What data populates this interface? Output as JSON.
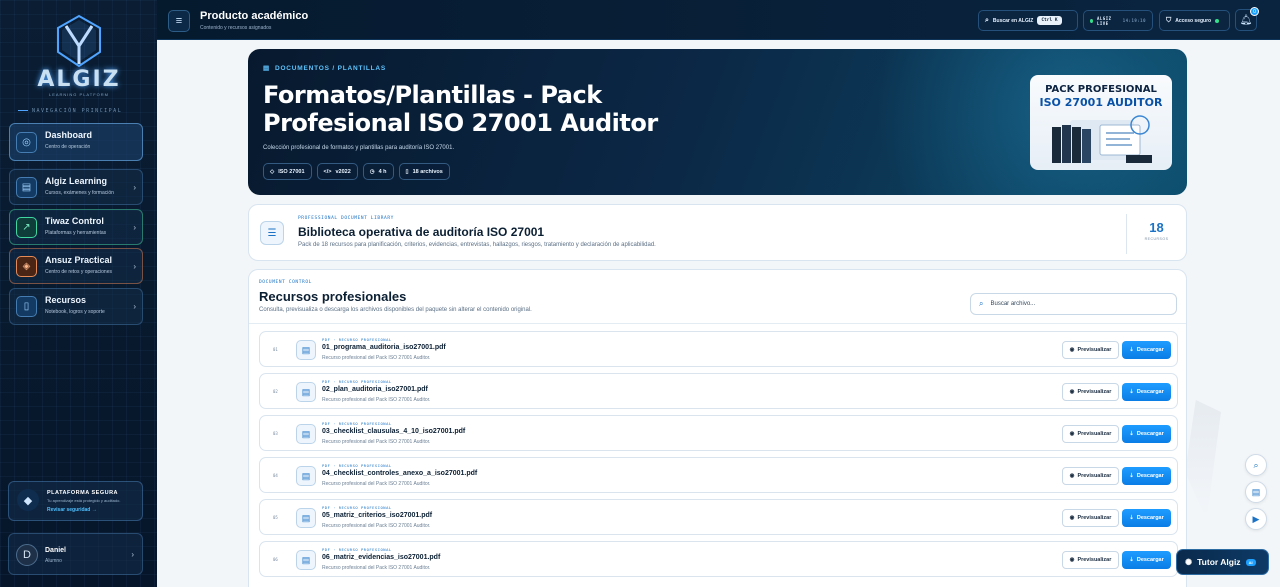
{
  "sidebar": {
    "logo_text": "ALGIZ",
    "logo_sub": "LEARNING PLATFORM",
    "nav_title": "NAVEGACIÓN PRINCIPAL",
    "items": [
      {
        "label": "Dashboard",
        "sub": "Centro de operación",
        "icon": "target-icon"
      },
      {
        "label": "Algiz Learning",
        "sub": "Cursos, exámenes y formación",
        "icon": "book-icon"
      },
      {
        "label": "Tiwaz Control",
        "sub": "Plataformas y herramientas",
        "icon": "arrow-icon"
      },
      {
        "label": "Ansuz Practical",
        "sub": "Centro de retos y operaciones",
        "icon": "shield-icon"
      },
      {
        "label": "Recursos",
        "sub": "Notebook, logros y soporte",
        "icon": "doc-icon"
      }
    ],
    "secure": {
      "title": "PLATAFORMA SEGURA",
      "sub": "Tu aprendizaje está protegido y auditado.",
      "link": "Revisar seguridad →"
    },
    "user": {
      "name": "Daniel",
      "role": "Alumno",
      "initial": "D"
    }
  },
  "header": {
    "title": "Producto académico",
    "subtitle": "Contenido y recursos asignados",
    "search_label": "Buscar en ALGIZ",
    "search_kbd": "Ctrl K",
    "live_label": "ALGIZ LIVE",
    "live_time": "14:19:10",
    "secure_label": "Acceso seguro",
    "notif_count": "0"
  },
  "hero": {
    "breadcrumb": "DOCUMENTOS / PLANTILLAS",
    "title": "Formatos/Plantillas - Pack Profesional ISO 27001 Auditor",
    "description": "Colección profesional de formatos y plantillas para auditoría ISO 27001.",
    "chips": [
      "ISO 27001",
      "v2022",
      "4 h",
      "18 archivos"
    ],
    "cover_line1": "PACK PROFESIONAL",
    "cover_line2": "ISO 27001 AUDITOR"
  },
  "library": {
    "kicker": "PROFESSIONAL DOCUMENT LIBRARY",
    "title": "Biblioteca operativa de auditoría ISO 27001",
    "sub": "Pack de 18 recursos para planificación, criterios, evidencias, entrevistas, hallazgos, riesgos, tratamiento y declaración de aplicabilidad.",
    "count": "18",
    "count_label": "RECURSOS"
  },
  "resources": {
    "kicker": "DOCUMENT CONTROL",
    "title": "Recursos profesionales",
    "sub": "Consulta, previsualiza o descarga los archivos disponibles del paquete sin alterar el contenido original.",
    "search_placeholder": "Buscar archivo...",
    "preview_label": "Previsualizar",
    "download_label": "Descargar",
    "rows": [
      {
        "num": "01",
        "kicker": "PDF · RECURSO PROFESIONAL",
        "name": "01_programa_auditoria_iso27001.pdf",
        "desc": "Recurso profesional del Pack ISO 27001 Auditor."
      },
      {
        "num": "02",
        "kicker": "PDF · RECURSO PROFESIONAL",
        "name": "02_plan_auditoria_iso27001.pdf",
        "desc": "Recurso profesional del Pack ISO 27001 Auditor."
      },
      {
        "num": "03",
        "kicker": "PDF · RECURSO PROFESIONAL",
        "name": "03_checklist_clausulas_4_10_iso27001.pdf",
        "desc": "Recurso profesional del Pack ISO 27001 Auditor."
      },
      {
        "num": "04",
        "kicker": "PDF · RECURSO PROFESIONAL",
        "name": "04_checklist_controles_anexo_a_iso27001.pdf",
        "desc": "Recurso profesional del Pack ISO 27001 Auditor."
      },
      {
        "num": "05",
        "kicker": "PDF · RECURSO PROFESIONAL",
        "name": "05_matriz_criterios_iso27001.pdf",
        "desc": "Recurso profesional del Pack ISO 27001 Auditor."
      },
      {
        "num": "06",
        "kicker": "PDF · RECURSO PROFESIONAL",
        "name": "06_matriz_evidencias_iso27001.pdf",
        "desc": "Recurso profesional del Pack ISO 27001 Auditor."
      }
    ]
  },
  "tutor": {
    "label": "Tutor Algiz",
    "tag": "AI"
  },
  "colors": {
    "accent": "#1c73c6",
    "primary_button": "#1f9cff",
    "dark": "#0a1d33"
  }
}
